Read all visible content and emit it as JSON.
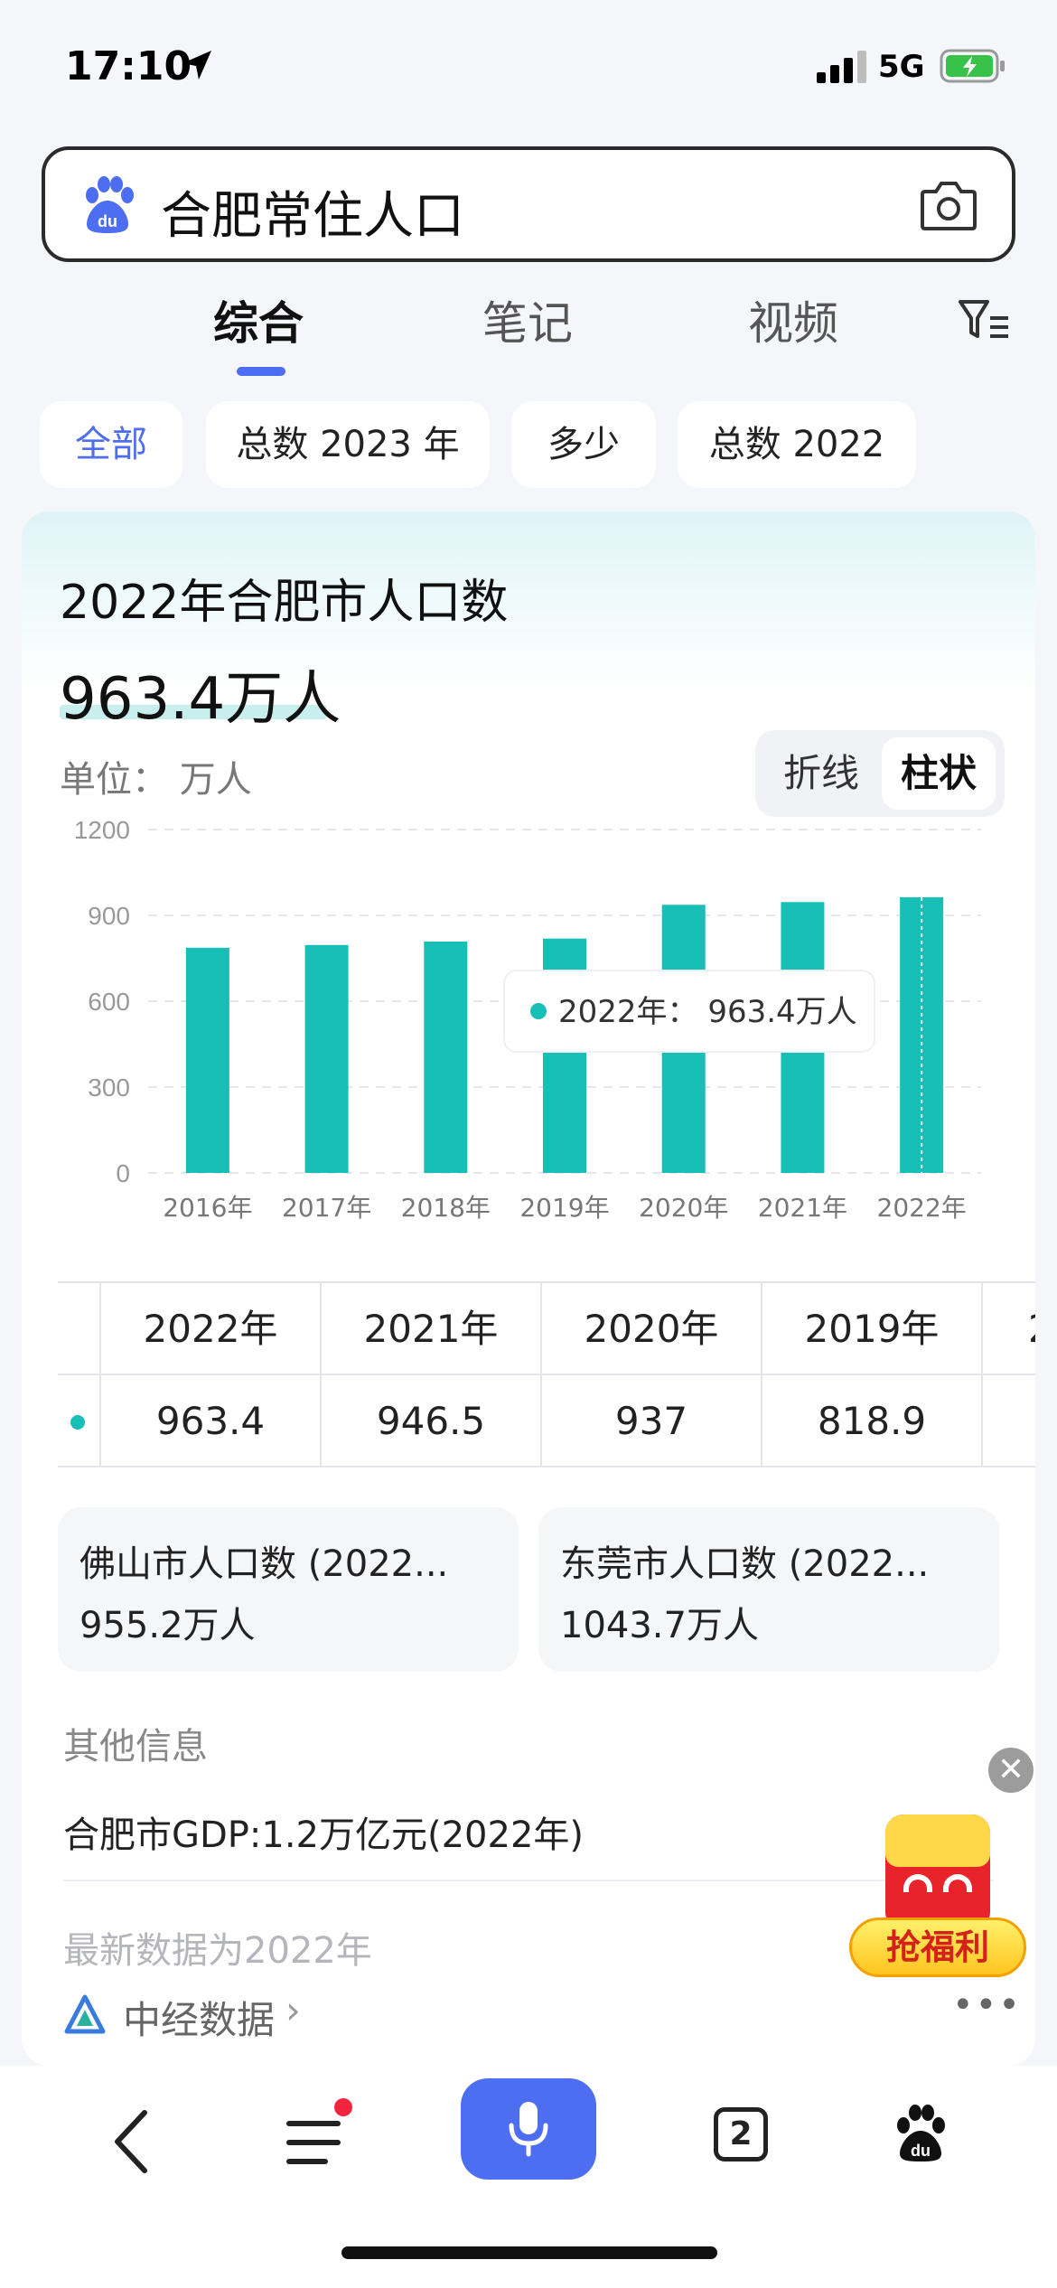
{
  "status_bar": {
    "time": "17:10",
    "network": "5G"
  },
  "search": {
    "query": "合肥常住人口"
  },
  "tabs": [
    {
      "label": "综合",
      "active": true
    },
    {
      "label": "笔记",
      "active": false
    },
    {
      "label": "视频",
      "active": false
    }
  ],
  "chips": [
    {
      "label": "全部",
      "active": true
    },
    {
      "label": "总数 2023 年",
      "active": false
    },
    {
      "label": "多少",
      "active": false
    },
    {
      "label": "总数 2022",
      "active": false
    }
  ],
  "card": {
    "title": "2022年合肥市人口数",
    "value": "963.4万人",
    "unit_label": "单位：  万人",
    "toggle": {
      "line": "折线",
      "bar": "柱状",
      "active": "bar"
    }
  },
  "chart_data": {
    "type": "bar",
    "categories": [
      "2016年",
      "2017年",
      "2018年",
      "2019年",
      "2020年",
      "2021年",
      "2022年"
    ],
    "values": [
      786.9,
      796.5,
      808.7,
      818.9,
      937,
      946.5,
      963.4
    ],
    "ylim": [
      0,
      1200
    ],
    "yticks": [
      0,
      300,
      600,
      900,
      1200
    ],
    "grid": true,
    "highlighted_index": 6,
    "tooltip": "2022年：  963.4万人",
    "bar_color": "#17bfb7"
  },
  "table": {
    "headers": [
      "2022年",
      "2021年",
      "2020年",
      "2019年",
      "2"
    ],
    "values": [
      "963.4",
      "946.5",
      "937",
      "818.9",
      ""
    ]
  },
  "related": [
    {
      "title": "佛山市人口数 (2022...",
      "value": "955.2万人"
    },
    {
      "title": "东莞市人口数 (2022...",
      "value": "1043.7万人"
    }
  ],
  "other_info": {
    "label": "其他信息",
    "gdp": "合肥市GDP:1.2万亿元(2022年)",
    "latest": "最新数据为2022年",
    "source": "中经数据",
    "more": "•••"
  },
  "promo": {
    "label": "抢福利",
    "close": "✕"
  },
  "bottom_nav": {
    "tabs_count": "2"
  },
  "colors": {
    "accent": "#4e6ef2",
    "bar": "#17bfb7",
    "badge": "#f2243e"
  }
}
